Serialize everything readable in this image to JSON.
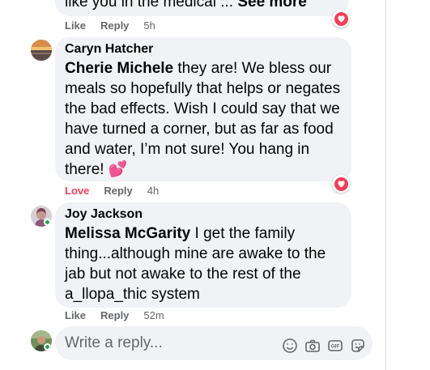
{
  "comments": [
    {
      "id": "top",
      "text_partial": "like you in the medical ...",
      "see_more": "See more",
      "actions": {
        "like": "Like",
        "reply": "Reply",
        "time": "5h"
      },
      "reaction": "love"
    },
    {
      "id": "caryn",
      "author": "Caryn Hatcher",
      "mention": "Cherie Michele",
      "lines": [
        " they are! We bless our",
        "meals so hopefully that helps or negates",
        "the bad effects. Wish I could say that we",
        "have turned a corner, but as far as food",
        "and water, I’m not sure! You hang in",
        "there! 💕"
      ],
      "actions": {
        "like": "Love",
        "reply": "Reply",
        "time": "4h"
      },
      "reaction": "love"
    },
    {
      "id": "joy",
      "author": "Joy Jackson",
      "mention": "Melissa McGarity",
      "lines": [
        " I get the family",
        "thing...although mine are awake to the",
        "jab but not awake to the rest of the",
        "a_llopa_thic system"
      ],
      "actions": {
        "like": "Like",
        "reply": "Reply",
        "time": "52m"
      },
      "online": true
    }
  ],
  "reply_box": {
    "placeholder": "Write a reply...",
    "icons": [
      "emoji-icon",
      "camera-icon",
      "gif-icon",
      "sticker-icon"
    ]
  },
  "colors": {
    "bubble": "#f0f2f5",
    "love": "#f33e58",
    "meta": "#65676b",
    "online": "#31a24c"
  }
}
